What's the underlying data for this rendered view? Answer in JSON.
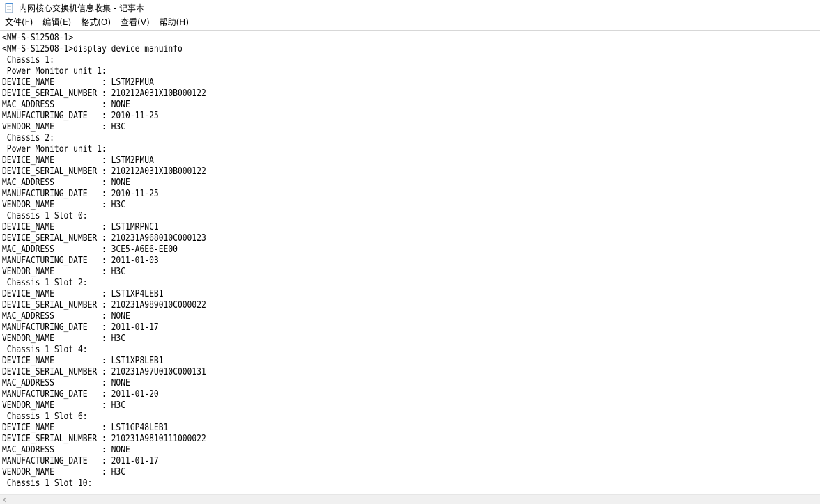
{
  "window": {
    "title": "内网核心交换机信息收集 - 记事本"
  },
  "menu": {
    "file": "文件(F)",
    "edit": "编辑(E)",
    "format": "格式(O)",
    "view": "查看(V)",
    "help": "帮助(H)"
  },
  "editor": {
    "lines": [
      "<NW-S-S12508-1>",
      "<NW-S-S12508-1>display device manuinfo",
      " Chassis 1:",
      " Power Monitor unit 1:",
      "DEVICE_NAME          : LSTM2PMUA",
      "DEVICE_SERIAL_NUMBER : 210212A031X10B000122",
      "MAC_ADDRESS          : NONE",
      "MANUFACTURING_DATE   : 2010-11-25",
      "VENDOR_NAME          : H3C",
      " Chassis 2:",
      " Power Monitor unit 1:",
      "DEVICE_NAME          : LSTM2PMUA",
      "DEVICE_SERIAL_NUMBER : 210212A031X10B000122",
      "MAC_ADDRESS          : NONE",
      "MANUFACTURING_DATE   : 2010-11-25",
      "VENDOR_NAME          : H3C",
      " Chassis 1 Slot 0:",
      "DEVICE_NAME          : LST1MRPNC1",
      "DEVICE_SERIAL_NUMBER : 210231A968010C000123",
      "MAC_ADDRESS          : 3CE5-A6E6-EE00",
      "MANUFACTURING_DATE   : 2011-01-03",
      "VENDOR_NAME          : H3C",
      " Chassis 1 Slot 2:",
      "DEVICE_NAME          : LST1XP4LEB1",
      "DEVICE_SERIAL_NUMBER : 210231A989010C000022",
      "MAC_ADDRESS          : NONE",
      "MANUFACTURING_DATE   : 2011-01-17",
      "VENDOR_NAME          : H3C",
      " Chassis 1 Slot 4:",
      "DEVICE_NAME          : LST1XP8LEB1",
      "DEVICE_SERIAL_NUMBER : 210231A97U010C000131",
      "MAC_ADDRESS          : NONE",
      "MANUFACTURING_DATE   : 2011-01-20",
      "VENDOR_NAME          : H3C",
      " Chassis 1 Slot 6:",
      "DEVICE_NAME          : LST1GP48LEB1",
      "DEVICE_SERIAL_NUMBER : 210231A9810111000022",
      "MAC_ADDRESS          : NONE",
      "MANUFACTURING_DATE   : 2011-01-17",
      "VENDOR_NAME          : H3C",
      " Chassis 1 Slot 10:"
    ]
  },
  "icons": {
    "app": "notepad-icon",
    "scroll_left": "chevron-left-icon"
  },
  "colors": {
    "background": "#ffffff",
    "text": "#000000",
    "scrollbar": "#f0f0f0",
    "divider": "#d7d7d7"
  }
}
